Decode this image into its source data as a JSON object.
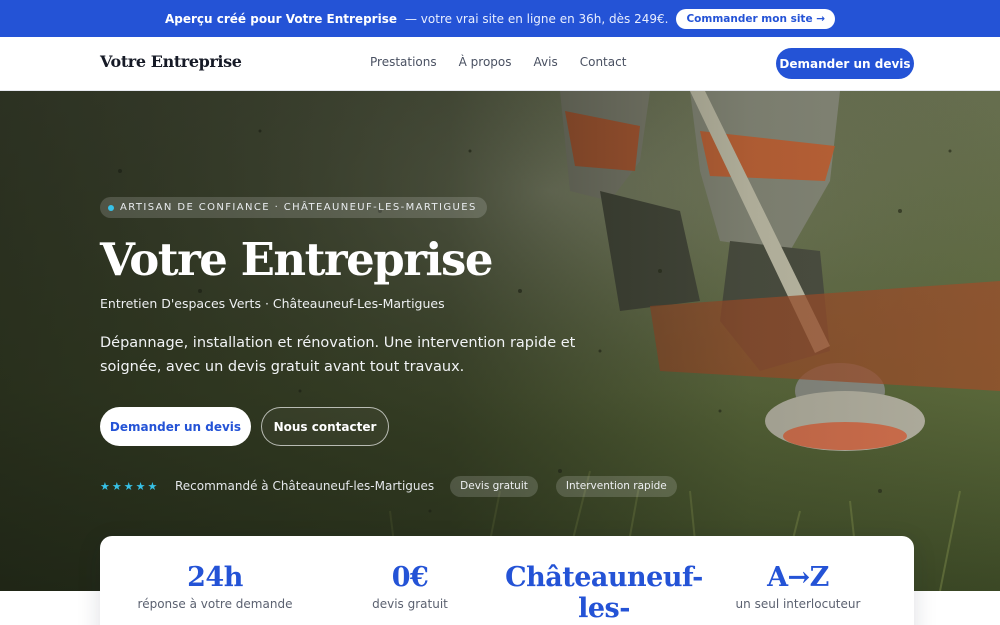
{
  "promo": {
    "prefix": "Aperçu créé pour Votre Entreprise",
    "rest": "— votre vrai site en ligne en 36h, dès 249€.",
    "button": "Commander mon site →"
  },
  "nav": {
    "brand": "Votre Entreprise",
    "links": [
      "Prestations",
      "À propos",
      "Avis",
      "Contact"
    ],
    "cta": "Demander un devis"
  },
  "hero": {
    "eyebrow": "ARTISAN DE CONFIANCE · CHÂTEAUNEUF-LES-MARTIGUES",
    "title": "Votre Entreprise",
    "subtitle": "Entretien D'espaces Verts · Châteauneuf-Les-Martigues",
    "description": "Dépannage, installation et rénovation. Une intervention rapide et soignée, avec un devis gratuit avant tout travaux.",
    "primary_button": "Demander un devis",
    "secondary_button": "Nous contacter",
    "stars": "★★★★★",
    "recommendation": "Recommandé à Châteauneuf-les-Martigues",
    "chips": [
      "Devis gratuit",
      "Intervention rapide"
    ]
  },
  "stats": [
    {
      "value": "24h",
      "label": "réponse à votre demande"
    },
    {
      "value": "0€",
      "label": "devis gratuit"
    },
    {
      "value": "Châteauneuf-les-",
      "label": ""
    },
    {
      "value": "A→Z",
      "label": "un seul interlocuteur"
    }
  ],
  "colors": {
    "accent": "#2453d6",
    "star": "#37c1e7"
  }
}
